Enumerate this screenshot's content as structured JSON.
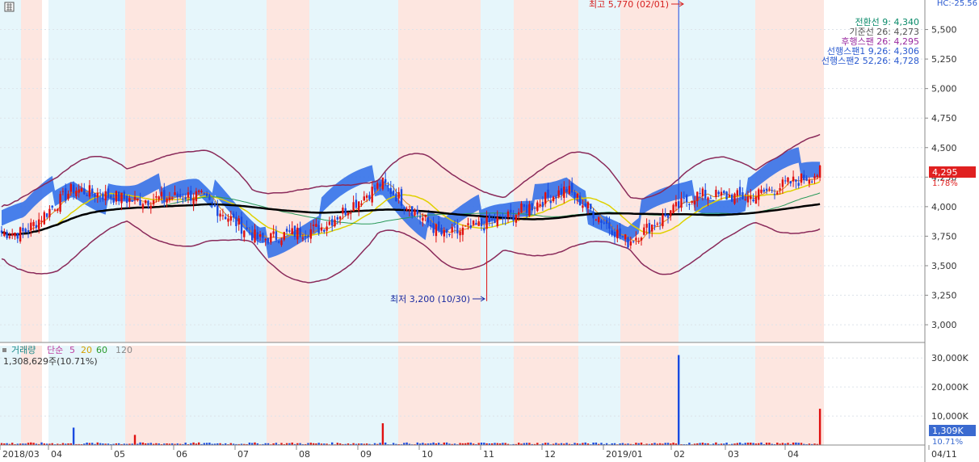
{
  "toolbar": {
    "grid_icon": "grid-icon",
    "corner_label": "HC:-25.56"
  },
  "chart_data": [
    {
      "type": "candlestick",
      "ylim": [
        2850,
        5750
      ],
      "y_ticks": [
        "3,000",
        "3,250",
        "3,500",
        "3,750",
        "4,000",
        "4,250",
        "4,500",
        "4,750",
        "5,000",
        "5,250",
        "5,500"
      ],
      "x_ticks": [
        "2018/03",
        "04",
        "05",
        "06",
        "07",
        "08",
        "09",
        "10",
        "11",
        "12",
        "2019/01",
        "02",
        "03",
        "04",
        "04/11"
      ],
      "legend": [
        {
          "label": "전환선 9: 4,340",
          "color": "#0a8a6a"
        },
        {
          "label": "기준선 26: 4,273",
          "color": "#555555"
        },
        {
          "label": "후행스팬 26: 4,295",
          "color": "#9a2aa0"
        },
        {
          "label": "선행스팬1 9,26: 4,306",
          "color": "#2a5ad0"
        },
        {
          "label": "선행스팬2 52,26: 4,728",
          "color": "#2a5ad0"
        }
      ],
      "annotations": {
        "high": "최고 5,770 (02/01)",
        "low": "최저 3,200 (10/30)"
      },
      "price_badge": {
        "price": "4,295",
        "change": "1.78%"
      },
      "key_points": [
        {
          "date": "2018/03",
          "close": 3780
        },
        {
          "date": "2018/04",
          "close": 4150
        },
        {
          "date": "2018/05",
          "close": 4050
        },
        {
          "date": "2018/06",
          "close": 4100
        },
        {
          "date": "2018/07",
          "close": 3720
        },
        {
          "date": "2018/08",
          "close": 3820
        },
        {
          "date": "2018/09",
          "close": 4200
        },
        {
          "date": "2018/10",
          "close": 3750
        },
        {
          "date": "2018/10/30",
          "low": 3200
        },
        {
          "date": "2018/11",
          "close": 3900
        },
        {
          "date": "2018/12",
          "close": 4150
        },
        {
          "date": "2019/01",
          "close": 3700
        },
        {
          "date": "2019/02/01",
          "high": 5770
        },
        {
          "date": "2019/02",
          "close": 4100
        },
        {
          "date": "2019/03",
          "close": 4080
        },
        {
          "date": "2019/04/11",
          "close": 4295
        }
      ]
    },
    {
      "type": "bar",
      "ylim": [
        0,
        32000
      ],
      "y_ticks": [
        "10,000K",
        "20,000K",
        "30,000K"
      ],
      "legend": [
        {
          "label": "거래량",
          "color": "#1a8a8a"
        },
        {
          "label": "단순",
          "color": "#c040a0"
        },
        {
          "label": "5",
          "color": "#c040a0"
        },
        {
          "label": "20",
          "color": "#d4a000"
        },
        {
          "label": "60",
          "color": "#2a9a2a"
        },
        {
          "label": "120",
          "color": "#888888"
        }
      ],
      "volume_label": "1,308,629주(10.71%)",
      "volume_badge": {
        "value": "1,309K",
        "pct": "10.71%"
      },
      "spikes": [
        {
          "date": "2018/04",
          "value": 6000
        },
        {
          "date": "2018/05",
          "value": 3500
        },
        {
          "date": "2018/09",
          "value": 7500
        },
        {
          "date": "2019/02/01",
          "value": 31000
        },
        {
          "date": "2019/04/11",
          "value": 12500
        }
      ]
    }
  ]
}
